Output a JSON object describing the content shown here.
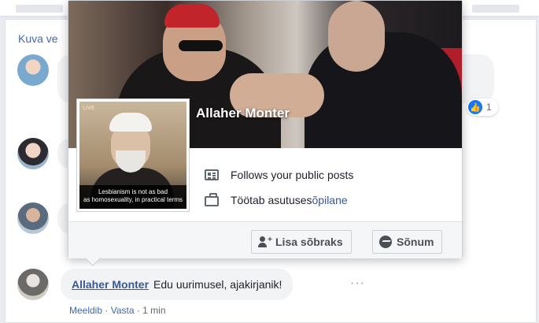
{
  "feed": {
    "view_more": "Kuva ve",
    "reaction_count": "1",
    "reaction_icon": "like-thumb-icon"
  },
  "hovercard": {
    "name": "Allaher Monter",
    "profile_caption_line1": "Lesbianism is not as bad",
    "profile_caption_line2": "as homosexuality, in practical terms",
    "profile_watermark": "LIVE",
    "follows": "Follows your public posts",
    "works_prefix": "Töötab asutuses ",
    "works_org": "õpilane",
    "add_friend_label": "Lisa sõbraks",
    "message_label": "Sõnum"
  },
  "comment": {
    "author": "Allaher Monter",
    "text": "Edu uurimusel, ajakirjanik!",
    "more": "···",
    "like": "Meeldib",
    "sep1": " · ",
    "reply": "Vasta",
    "sep2": " · ",
    "time": "1 min"
  },
  "colors": {
    "link": "#385898",
    "brand": "#4267b2",
    "like_blue": "#1877f2"
  }
}
